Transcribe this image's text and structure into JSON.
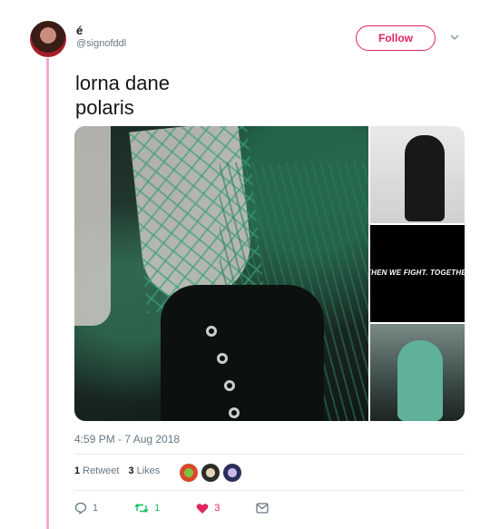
{
  "user": {
    "name": "é",
    "handle": "@signofddl"
  },
  "follow_label": "Follow",
  "tweet": {
    "line1": "lorna dane",
    "line2": "polaris"
  },
  "media": {
    "overlay_text": "THEN WE FIGHT. TOGETHER"
  },
  "timestamp": "4:59 PM - 7 Aug 2018",
  "stats": {
    "retweets_count": "1",
    "retweets_label": "Retweet",
    "likes_count": "3",
    "likes_label": "Likes"
  },
  "actions": {
    "reply_count": "1",
    "retweet_count": "1",
    "like_count": "3"
  },
  "colors": {
    "accent": "#e0245e",
    "retweet_green": "#17bf63",
    "thread": "#f5a9d0",
    "muted": "#657786"
  }
}
